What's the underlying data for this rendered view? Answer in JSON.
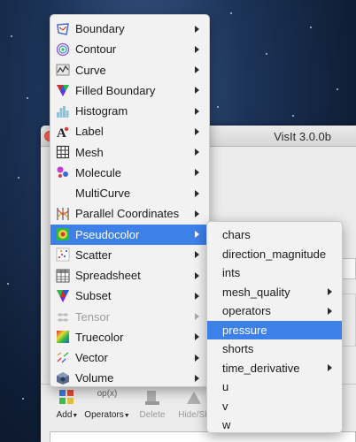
{
  "window": {
    "title": "VisIt 3.0.0b"
  },
  "toolbar": {
    "add_label": "Add",
    "operators_label": "Operators",
    "operators_icon_text": "op(x)",
    "delete_label": "Delete",
    "hide_show_label": "Hide/Sh"
  },
  "plot_menu": {
    "items": [
      {
        "label": "Boundary",
        "icon": "boundary-icon",
        "enabled": true,
        "submenu": true
      },
      {
        "label": "Contour",
        "icon": "contour-icon",
        "enabled": true,
        "submenu": true
      },
      {
        "label": "Curve",
        "icon": "curve-icon",
        "enabled": true,
        "submenu": true
      },
      {
        "label": "Filled Boundary",
        "icon": "filled-boundary-icon",
        "enabled": true,
        "submenu": true
      },
      {
        "label": "Histogram",
        "icon": "histogram-icon",
        "enabled": true,
        "submenu": true
      },
      {
        "label": "Label",
        "icon": "label-icon",
        "enabled": true,
        "submenu": true
      },
      {
        "label": "Mesh",
        "icon": "mesh-icon",
        "enabled": true,
        "submenu": true
      },
      {
        "label": "Molecule",
        "icon": "molecule-icon",
        "enabled": true,
        "submenu": true
      },
      {
        "label": "MultiCurve",
        "icon": "",
        "enabled": true,
        "submenu": true
      },
      {
        "label": "Parallel Coordinates",
        "icon": "parallel-coordinates-icon",
        "enabled": true,
        "submenu": true
      },
      {
        "label": "Pseudocolor",
        "icon": "pseudocolor-icon",
        "enabled": true,
        "submenu": true,
        "highlighted": true
      },
      {
        "label": "Scatter",
        "icon": "scatter-icon",
        "enabled": true,
        "submenu": true
      },
      {
        "label": "Spreadsheet",
        "icon": "spreadsheet-icon",
        "enabled": true,
        "submenu": true
      },
      {
        "label": "Subset",
        "icon": "subset-icon",
        "enabled": true,
        "submenu": true
      },
      {
        "label": "Tensor",
        "icon": "tensor-icon",
        "enabled": false,
        "submenu": true
      },
      {
        "label": "Truecolor",
        "icon": "truecolor-icon",
        "enabled": true,
        "submenu": true
      },
      {
        "label": "Vector",
        "icon": "vector-icon",
        "enabled": true,
        "submenu": true
      },
      {
        "label": "Volume",
        "icon": "volume-icon",
        "enabled": true,
        "submenu": true
      }
    ]
  },
  "variable_menu": {
    "items": [
      {
        "label": "chars",
        "submenu": false
      },
      {
        "label": "direction_magnitude",
        "submenu": false
      },
      {
        "label": "ints",
        "submenu": false
      },
      {
        "label": "mesh_quality",
        "submenu": true
      },
      {
        "label": "operators",
        "submenu": true
      },
      {
        "label": "pressure",
        "submenu": false,
        "highlighted": true
      },
      {
        "label": "shorts",
        "submenu": false
      },
      {
        "label": "time_derivative",
        "submenu": true
      },
      {
        "label": "u",
        "submenu": false
      },
      {
        "label": "v",
        "submenu": false
      },
      {
        "label": "w",
        "submenu": false
      }
    ]
  },
  "colors": {
    "highlight": "#3d80e8",
    "menu_background": "#f2f2f2",
    "disabled_text": "#9d9d9d"
  }
}
